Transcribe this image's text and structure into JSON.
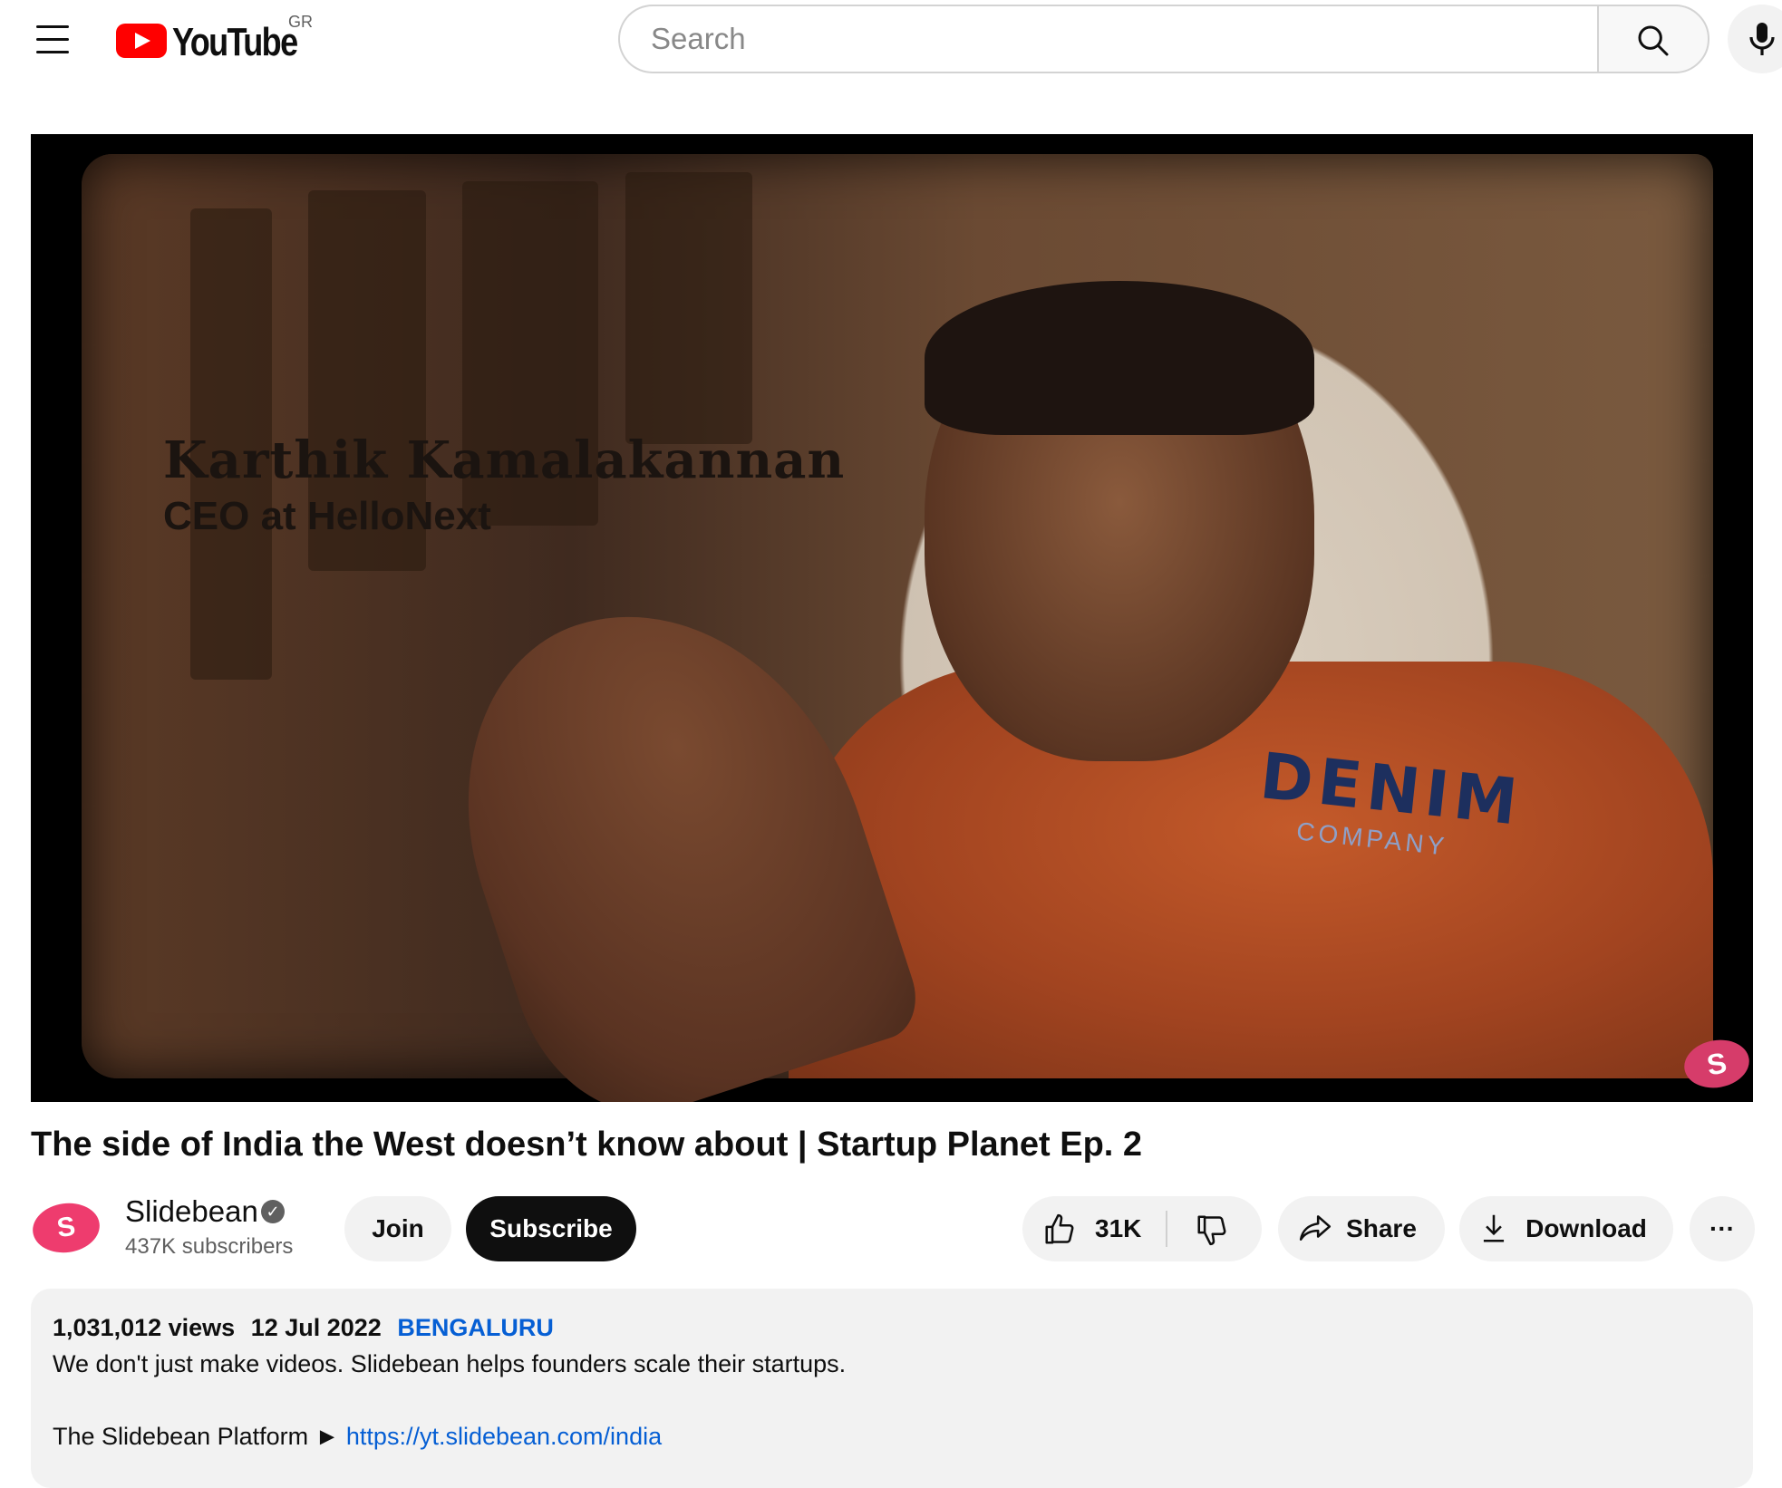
{
  "header": {
    "logo_text": "YouTube",
    "region": "GR",
    "search_placeholder": "Search"
  },
  "player": {
    "overlay_name": "Karthik Kamalakannan",
    "overlay_role": "CEO at HelloNext",
    "shirt_text": "DENIM",
    "shirt_subtext": "COMPANY",
    "watermark": "S"
  },
  "video": {
    "title": "The side of India the West doesn’t know about | Startup Planet Ep. 2"
  },
  "channel": {
    "avatar_letter": "S",
    "name": "Slidebean",
    "verified_mark": "✓",
    "subscribers": "437K subscribers",
    "join_label": "Join",
    "subscribe_label": "Subscribe"
  },
  "actions": {
    "like_count": "31K",
    "share_label": "Share",
    "download_label": "Download",
    "more_label": "···"
  },
  "description": {
    "views": "1,031,012 views",
    "date": "12 Jul 2022",
    "location": "BENGALURU",
    "line1": "We don't just make videos. Slidebean helps founders scale their startups.",
    "platform_label": "The Slidebean Platform ►",
    "platform_link": "https://yt.slidebean.com/india"
  },
  "colors": {
    "brand_red": "#ff0000",
    "link_blue": "#065fd4",
    "avatar_pink": "#ee3c6e"
  }
}
